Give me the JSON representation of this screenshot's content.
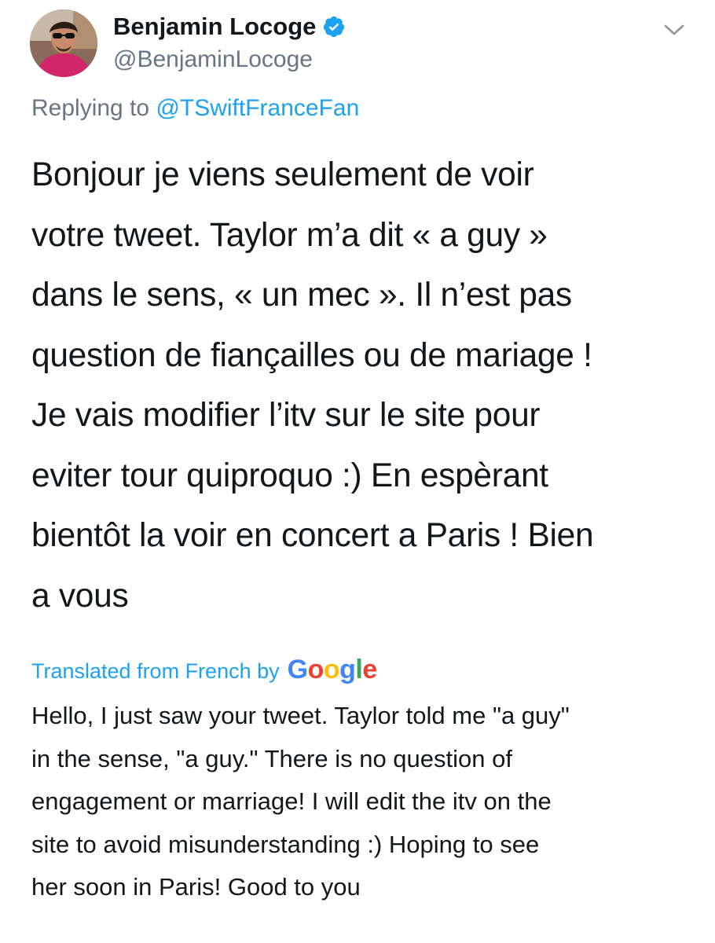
{
  "author": {
    "display_name": "Benjamin Locoge",
    "handle": "@BenjaminLocoge",
    "verified": true,
    "avatar_icon": "profile-photo"
  },
  "reply": {
    "prefix": "Replying to ",
    "mention": "@TSwiftFranceFan"
  },
  "tweet": {
    "text_lines": [
      "Bonjour je viens seulement de voir",
      "votre tweet. Taylor m’a dit « a guy »",
      "dans le sens, « un mec ». Il n’est pas",
      "question de fiançailles ou de mariage !",
      "Je vais modifier l’itv sur le site pour",
      "eviter tour quiproquo :) En espèrant",
      "bientôt la voir en concert a Paris ! Bien",
      "a vous"
    ]
  },
  "translation": {
    "label": "Translated from French by",
    "provider": "Google",
    "text_lines": [
      "Hello, I just saw your tweet. Taylor told me \"a guy\"",
      "in the sense, \"a guy.\" There is no question of",
      "engagement or marriage! I will edit the itv on the",
      "site to avoid misunderstanding :) Hoping to see",
      "her soon in Paris! Good to you"
    ]
  },
  "icons": {
    "verified": "verified-badge-icon",
    "menu": "chevron-down-icon"
  },
  "colors": {
    "link_blue": "#1da1f2",
    "secondary_gray": "#657786",
    "text": "#14171a"
  }
}
